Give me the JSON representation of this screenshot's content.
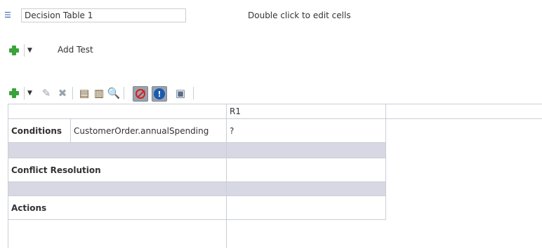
{
  "header": {
    "table_name": "Decision Table 1",
    "hint": "Double click to edit cells"
  },
  "test_toolbar": {
    "add_test_label": "Add Test"
  },
  "icons": {
    "collapse": "double-chevron-down-icon",
    "add": "green-plus-icon",
    "dropdown": "dropdown-arrow-icon",
    "edit": "pencil-icon",
    "delete": "delete-x-icon",
    "insert_col_before": "insert-column-icon",
    "insert_col_after": "insert-column-after-icon",
    "find": "find-icon",
    "gap_analysis": "no-entry-icon",
    "conflicts": "alert-icon",
    "compact": "compact-table-icon"
  },
  "colors": {
    "band": "#d7d8e4",
    "border": "#c9cfd6",
    "add_green": "#3aa33a",
    "stop_red": "#d42020",
    "alert_blue": "#1c5ab0"
  },
  "table": {
    "rule_header": "R1",
    "conditions_label": "Conditions",
    "condition_expression": "CustomerOrder.annualSpending",
    "condition_value": "?",
    "conflict_label": "Conflict Resolution",
    "actions_label": "Actions"
  }
}
